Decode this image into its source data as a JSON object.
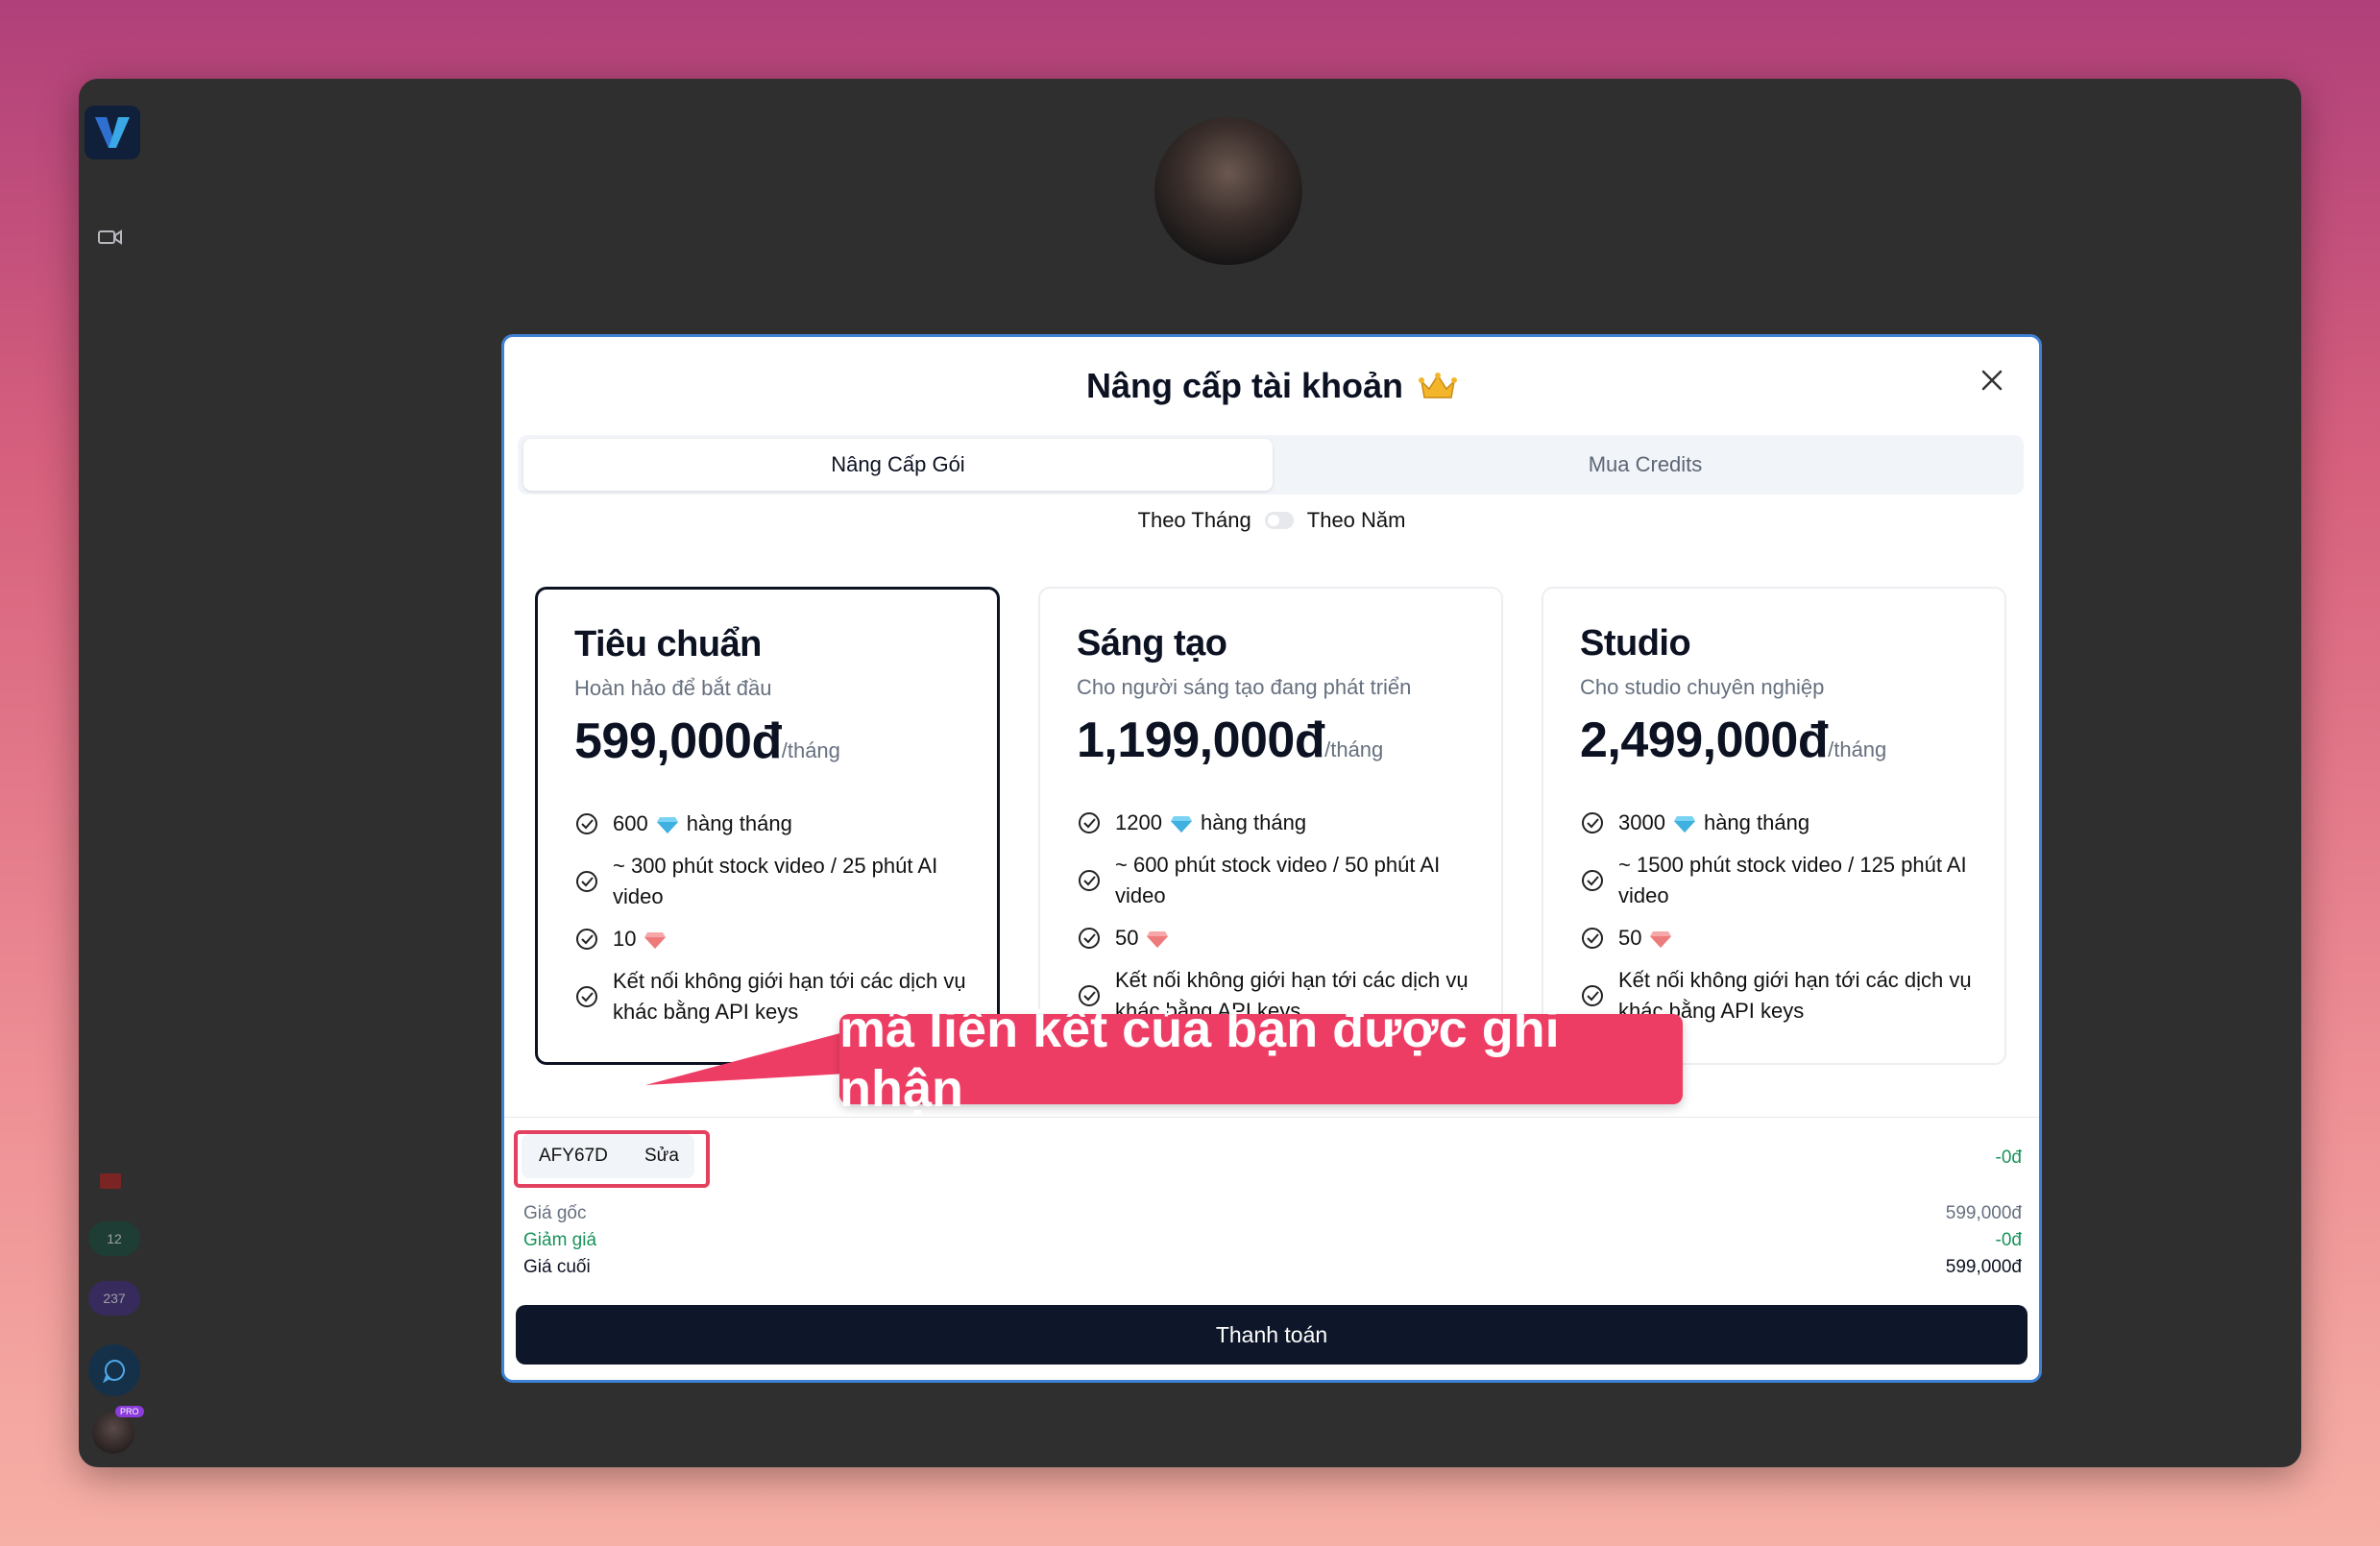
{
  "colors": {
    "accent": "#3e82d6",
    "callout": "#ee3d64",
    "highlight_frame": "#e4405f",
    "discount_green": "#18935a",
    "pay_button": "#0d1729"
  },
  "sidebar": {
    "logo_icon": "app-logo-v",
    "video_icon": "video-camera-icon",
    "flag_icon": "vietnam-flag-icon",
    "credits_badge_1": "12",
    "credits_badge_2": "237",
    "chat_icon": "chat-bubble-icon",
    "pro_label": "PRO"
  },
  "modal": {
    "title": "Nâng cấp tài khoản",
    "title_icon": "crown-emoji",
    "tabs": [
      {
        "label": "Nâng Cấp Gói",
        "active": true
      },
      {
        "label": "Mua Credits",
        "active": false
      }
    ],
    "billing_toggle": {
      "left": "Theo Tháng",
      "right": "Theo Năm",
      "on": false
    },
    "plans": [
      {
        "name": "Tiêu chuẩn",
        "description": "Hoàn hảo để bắt đầu",
        "price": "599,000đ",
        "period": "/tháng",
        "selected": true,
        "features": {
          "gems_amount": "600",
          "gems_suffix": "hàng tháng",
          "video": "~ 300 phút stock video / 25 phút AI video",
          "credits_amount": "10",
          "api": "Kết nối không giới hạn tới các dịch vụ khác bằng API keys"
        }
      },
      {
        "name": "Sáng tạo",
        "description": "Cho người sáng tạo đang phát triển",
        "price": "1,199,000đ",
        "period": "/tháng",
        "selected": false,
        "features": {
          "gems_amount": "1200",
          "gems_suffix": "hàng tháng",
          "video": "~ 600 phút stock video / 50 phút AI video",
          "credits_amount": "50",
          "api": "Kết nối không giới hạn tới các dịch vụ khác bằng API keys"
        }
      },
      {
        "name": "Studio",
        "description": "Cho studio chuyên nghiệp",
        "price": "2,499,000đ",
        "period": "/tháng",
        "selected": false,
        "features": {
          "gems_amount": "3000",
          "gems_suffix": "hàng tháng",
          "video": "~ 1500 phút stock video / 125 phút AI video",
          "credits_amount": "50",
          "api": "Kết nối không giới hạn tới các dịch vụ khác bằng API keys"
        }
      }
    ],
    "referral": {
      "code": "AFY67D",
      "edit_label": "Sửa",
      "discount_top": "-0đ"
    },
    "summary": [
      {
        "label": "Giá gốc",
        "value": "599,000đ",
        "style": "normal"
      },
      {
        "label": "Giảm giá",
        "value": "-0đ",
        "style": "green"
      },
      {
        "label": "Giá cuối",
        "value": "599,000đ",
        "style": "final"
      }
    ],
    "pay_label": "Thanh toán"
  },
  "annotation": {
    "callout_text": "mã liên kết của bạn được ghi nhận"
  }
}
